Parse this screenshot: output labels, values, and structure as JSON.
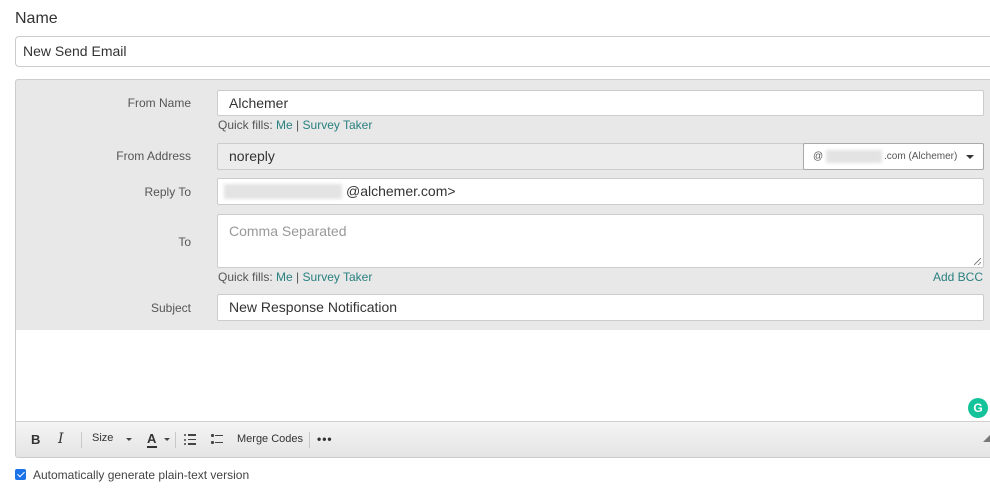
{
  "name_section": {
    "label": "Name",
    "value": "New Send Email"
  },
  "form": {
    "from_name": {
      "label": "From Name",
      "value": "Alchemer",
      "quick_fills_prefix": "Quick fills:",
      "quick_fill_me": "Me",
      "quick_fill_separator": "|",
      "quick_fill_survey_taker": "Survey Taker"
    },
    "from_address": {
      "label": "From Address",
      "value": "noreply",
      "domain_at": "@",
      "domain_suffix": ".com (Alchemer)"
    },
    "reply_to": {
      "label": "Reply To",
      "value_visible": "@alchemer.com>"
    },
    "to": {
      "label": "To",
      "placeholder": "Comma Separated",
      "quick_fills_prefix": "Quick fills:",
      "quick_fill_me": "Me",
      "quick_fill_separator": "|",
      "quick_fill_survey_taker": "Survey Taker",
      "add_bcc": "Add BCC"
    },
    "subject": {
      "label": "Subject",
      "value": "New Response Notification"
    }
  },
  "toolbar": {
    "bold": "B",
    "italic": "I",
    "size": "Size",
    "font_color": "A",
    "merge_codes": "Merge Codes",
    "more": "•••"
  },
  "grammarly_glyph": "G",
  "plaintext_option": {
    "label": "Automatically generate plain-text version",
    "checked": true
  },
  "colors": {
    "link": "#2a8080",
    "panel_bg": "#e8e8e8",
    "checkbox": "#1a73e8",
    "grammarly": "#15c39a"
  }
}
